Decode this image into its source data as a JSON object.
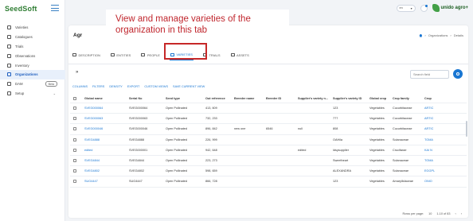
{
  "brand": {
    "logo": "SeedSoft",
    "partner": "unido agro+"
  },
  "topbar": {
    "language": "en"
  },
  "sidebar": {
    "items": [
      {
        "label": "Varieties"
      },
      {
        "label": "Catalogues"
      },
      {
        "label": "Trials"
      },
      {
        "label": "Observations"
      },
      {
        "label": "Inventory"
      },
      {
        "label": "Organizations"
      },
      {
        "label": "DAM",
        "badge": "Beta"
      },
      {
        "label": "Setup"
      }
    ]
  },
  "page": {
    "title": "Agr",
    "breadcrumb": [
      "Organizations",
      "Details"
    ]
  },
  "tabs": [
    "DESCRIPTION",
    "ENTITIES",
    "PEOPLE",
    "VARIETIES",
    "TRIALS",
    "ASSETS"
  ],
  "search": {
    "placeholder": "Search field"
  },
  "toolbar": [
    "COLUMNS",
    "FILTERS",
    "DENSITY",
    "EXPORT",
    "CUSTOM VIEWS",
    "SAVE CURRENT VIEW"
  ],
  "table": {
    "headers": [
      "Global name",
      "Serial No",
      "Seed type",
      "Out reference",
      "Breeder name",
      "Breeder ID",
      "Supplier's variety n...",
      "Supplier's variety ID",
      "Global crop",
      "Crop family",
      "Crop"
    ],
    "rows": [
      [
        "SVEG000064",
        "SVEG000064",
        "Open Pollinated",
        "413, 609",
        "",
        "",
        "",
        "123",
        "Vegetables",
        "Cucurbitaceae",
        "ARTIC"
      ],
      [
        "SVEG000063",
        "SVEG000063",
        "Open Pollinated",
        "732, 233",
        "",
        "",
        "",
        "777",
        "Vegetables",
        "Cucurbitaceae",
        "ARTIC"
      ],
      [
        "SVEG000046",
        "SVEG000046",
        "Open Pollinated",
        "896, 842",
        "new one",
        "6546",
        "null",
        "808",
        "Vegetables",
        "Cucurbitaceae",
        "ARTIC"
      ],
      [
        "SVEG4888",
        "SVEG4888",
        "Open Pollinated",
        "226, 999",
        "",
        "",
        "",
        "OAHila",
        "Vegetables",
        "Solanaceae",
        "TOMA"
      ],
      [
        "edited",
        "SVEG000001",
        "Open Pollinated",
        "942, 648",
        "",
        "",
        "edited",
        "ldsysupplier",
        "Vegetables",
        "Crucifarae",
        "KAI N"
      ],
      [
        "SVEG4844",
        "SVEG4844",
        "Open Pollinated",
        "223, 273",
        "",
        "",
        "",
        "Sweetheart",
        "Vegetables",
        "Solanaceae",
        "TOMA"
      ],
      [
        "SVEG4802",
        "SVEG4802",
        "Open Pollinated",
        "598, 659",
        "",
        "",
        "",
        "ALEXANDRA",
        "Vegetables",
        "Solanaceae",
        "EGGPL"
      ],
      [
        "SUG4447",
        "SUG4447",
        "Open Pollinated",
        "866, 728",
        "",
        "",
        "",
        "123",
        "Vegetables",
        "Amaryllidaceae",
        "ONIO"
      ]
    ]
  },
  "pager": {
    "rows_label": "Rows per page:",
    "rows": "10",
    "range": "1-10 of 83"
  },
  "annotation": {
    "text_line1": "View and manage varieties of the",
    "text_line2": "organization in this tab"
  },
  "colors": {
    "accent": "#1976d2",
    "annotation": "#c62828"
  }
}
